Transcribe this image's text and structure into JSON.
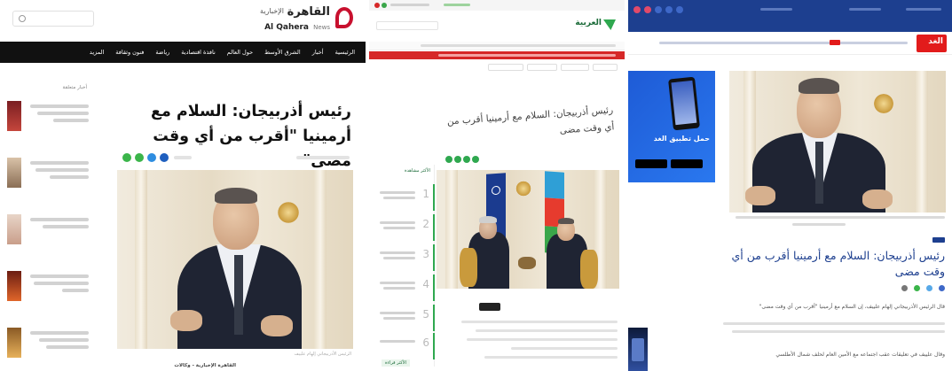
{
  "panel1": {
    "logo_ar": "القاهرة",
    "logo_ar2": "الإخبارية",
    "logo_en": "Al Qahera",
    "logo_en2": "News",
    "nav": [
      "الرئيسية",
      "أخبار",
      "الشرق الأوسط",
      "حول العالم",
      "نافذة اقتصادية",
      "رياضة",
      "فنون وثقافة",
      "المزيد"
    ],
    "sidebar_title": "أخبار متعلقة",
    "headline": "رئيس أذربيجان: السلام مع أرمينيا \"أقرب من أي وقت مضى\"",
    "photo_caption": "الرئيس الأذربيجاني إلهام علييف",
    "footer_text": "القاهرة الإخبارية - وكالات",
    "colors": {
      "header_bg": "#111111",
      "accent": "#c8102e",
      "share_green": "#3bb54a",
      "share_blue": "#1f5fbf"
    }
  },
  "panel2": {
    "logo": "العربية",
    "sidebar_title": "الأكثر مشاهدة",
    "numbers": [
      "1",
      "2",
      "3",
      "4",
      "5",
      "6"
    ],
    "headline": "رئيس أذربيجان: السلام مع أرمينيا أقرب من أي وقت مضى",
    "bottom_tag": "الأكثر قراءة",
    "colors": {
      "accent": "#2fa84f",
      "alert": "#d62828",
      "nato": "#1b3b8f",
      "azflag_blue": "#2f9fd6",
      "azflag_red": "#e63b2e",
      "azflag_green": "#3aa64a"
    }
  },
  "panel3": {
    "logo": "الغد",
    "app_promo": "حمل تطبيق الغد",
    "headline": "رئيس أذربيجان: السلام مع أرمينيا أقرب من أي وقت مضى",
    "body_line1": "قال الرئيس الأذربيجاني إلهام علييف، إن السلام مع أرمينيا \"أقرب من أي وقت مضى\"",
    "body_line2": "وقال علييف في تعليقات عقب اجتماعه مع الأمين العام لحلف شمال الأطلسي",
    "colors": {
      "header_bg": "#1d3f8f",
      "accent": "#e21b1b"
    }
  }
}
